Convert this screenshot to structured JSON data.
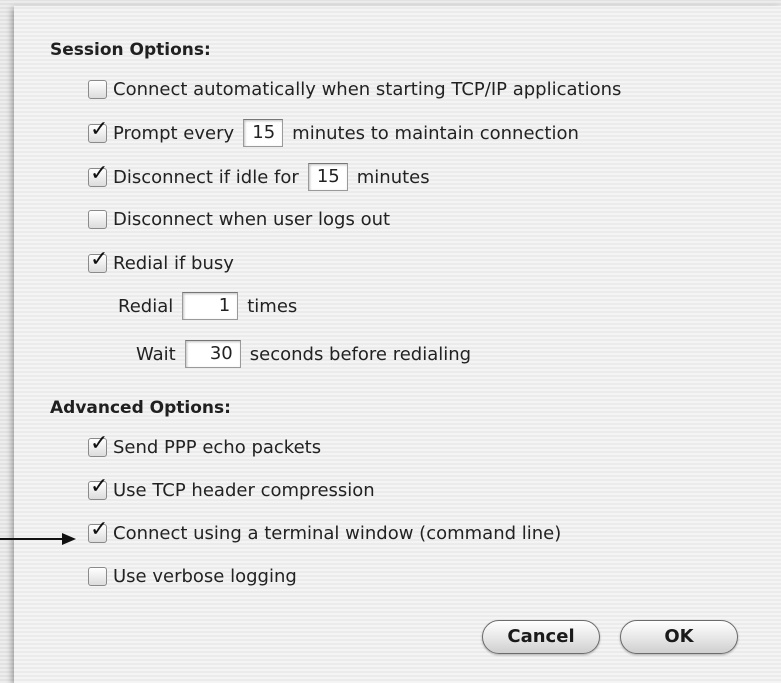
{
  "session_options": {
    "heading": "Session Options:",
    "connect_auto": {
      "label": "Connect automatically when starting TCP/IP applications",
      "checked": false
    },
    "prompt_every": {
      "before": "Prompt every",
      "value": "15",
      "after": "minutes to maintain connection",
      "checked": true
    },
    "disconnect_idle": {
      "before": "Disconnect if idle for",
      "value": "15",
      "after": "minutes",
      "checked": true
    },
    "disconnect_logout": {
      "label": "Disconnect when user logs out",
      "checked": false
    },
    "redial_busy": {
      "label": "Redial if busy",
      "checked": true
    },
    "redial_times": {
      "before": "Redial",
      "value": "1",
      "after": "times"
    },
    "wait": {
      "before": "Wait",
      "value": "30",
      "after": "seconds before redialing"
    }
  },
  "advanced_options": {
    "heading": "Advanced Options:",
    "ppp_echo": {
      "label": "Send PPP echo packets",
      "checked": true
    },
    "tcp_compression": {
      "label": "Use TCP header compression",
      "checked": true
    },
    "terminal_window": {
      "label": "Connect using a terminal window (command line)",
      "checked": true
    },
    "verbose_logging": {
      "label": "Use verbose logging",
      "checked": false
    }
  },
  "buttons": {
    "cancel": "Cancel",
    "ok": "OK"
  },
  "checkmark_glyph": "✓"
}
